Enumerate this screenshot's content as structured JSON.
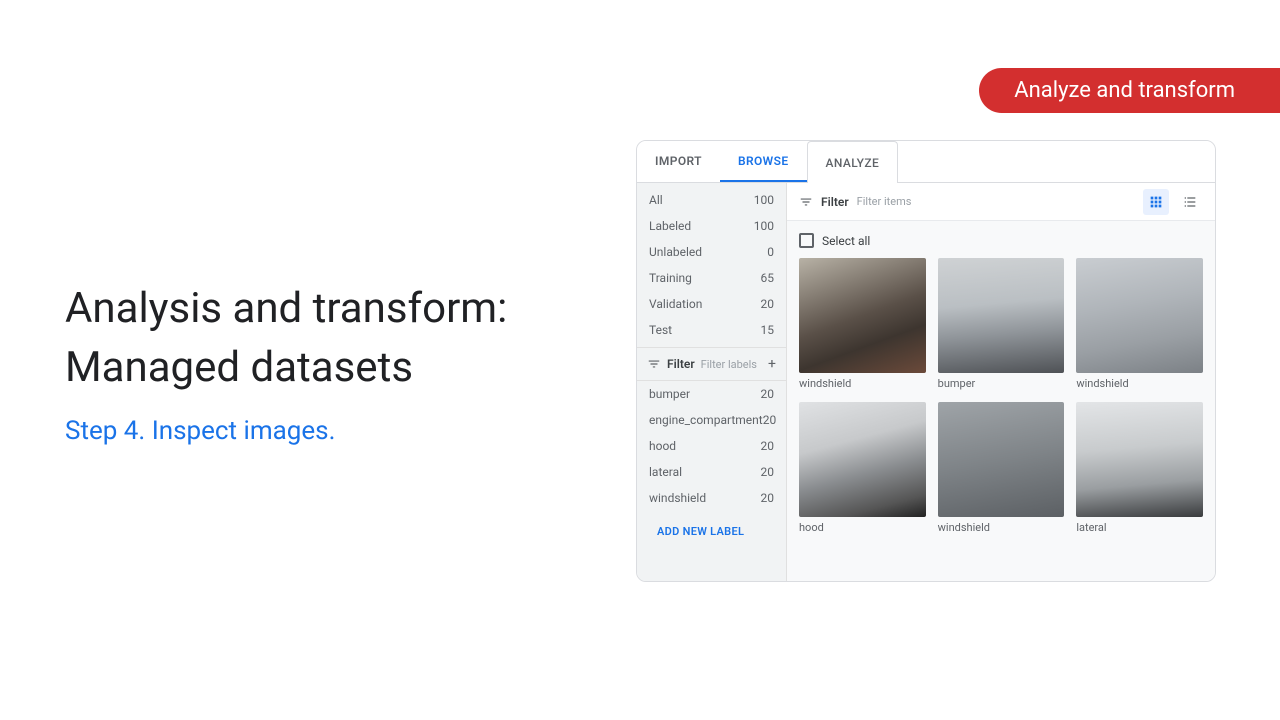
{
  "badge": "Analyze and transform",
  "left": {
    "title_line1": "Analysis and transform:",
    "title_line2": "Managed datasets",
    "step": "Step 4. Inspect images."
  },
  "tabs": {
    "import": "IMPORT",
    "browse": "BROWSE",
    "analyze": "ANALYZE"
  },
  "sidebar": {
    "counts": [
      {
        "label": "All",
        "value": "100"
      },
      {
        "label": "Labeled",
        "value": "100"
      },
      {
        "label": "Unlabeled",
        "value": "0"
      },
      {
        "label": "Training",
        "value": "65"
      },
      {
        "label": "Validation",
        "value": "20"
      },
      {
        "label": "Test",
        "value": "15"
      }
    ],
    "filter_label": "Filter",
    "filter_placeholder": "Filter labels",
    "labels": [
      {
        "name": "bumper",
        "count": "20"
      },
      {
        "name": "engine_compartment",
        "count": "20"
      },
      {
        "name": "hood",
        "count": "20"
      },
      {
        "name": "lateral",
        "count": "20"
      },
      {
        "name": "windshield",
        "count": "20"
      }
    ],
    "add_new_label": "ADD NEW LABEL"
  },
  "main": {
    "filter_label": "Filter",
    "filter_placeholder": "Filter items",
    "select_all": "Select all",
    "items": [
      {
        "label": "windshield"
      },
      {
        "label": "bumper"
      },
      {
        "label": "windshield"
      },
      {
        "label": "hood"
      },
      {
        "label": "windshield"
      },
      {
        "label": "lateral"
      }
    ]
  }
}
